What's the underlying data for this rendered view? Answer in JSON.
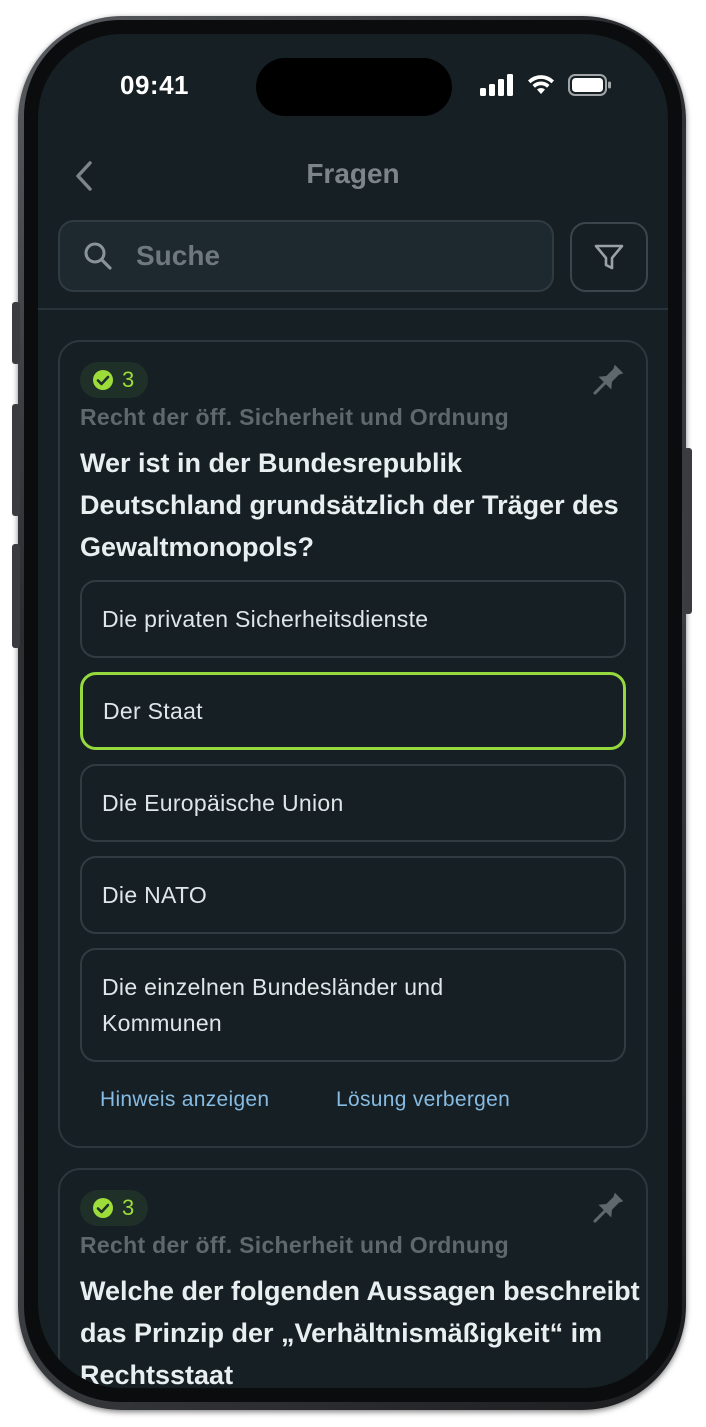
{
  "status_bar": {
    "time": "09:41"
  },
  "nav": {
    "title": "Fragen"
  },
  "search": {
    "placeholder": "Suche",
    "value": ""
  },
  "colors": {
    "accent_correct": "#95d93e",
    "link": "#86bbe3",
    "background": "#162024"
  },
  "cards": [
    {
      "badge_count": "3",
      "category": "Recht der öff. Sicherheit und Ordnung",
      "question": "Wer ist in der Bundesrepublik Deutschland grundsätzlich der Träger des Gewaltmonopols?",
      "answers": [
        {
          "label": "Die privaten Sicherheitsdienste",
          "correct": false
        },
        {
          "label": "Der Staat",
          "correct": true
        },
        {
          "label": "Die Europäische Union",
          "correct": false
        },
        {
          "label": "Die NATO",
          "correct": false
        },
        {
          "label": "Die einzelnen Bundesländer und Kommunen",
          "correct": false
        }
      ],
      "hint_label": "Hinweis anzeigen",
      "solution_label": "Lösung verbergen"
    },
    {
      "badge_count": "3",
      "category": "Recht der öff. Sicherheit und Ordnung",
      "question": "Welche der folgenden Aussagen beschreibt das Prinzip der „Verhältnismäßigkeit“ im Rechtsstaat"
    }
  ]
}
